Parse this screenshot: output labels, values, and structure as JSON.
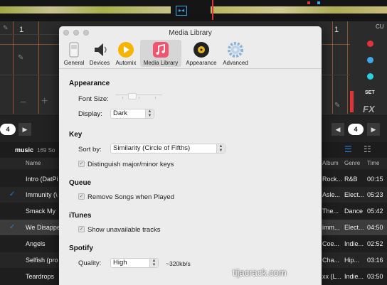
{
  "dialog": {
    "title": "Media Library",
    "tabs": [
      {
        "label": "General",
        "icon": "switch-icon"
      },
      {
        "label": "Devices",
        "icon": "speaker-icon"
      },
      {
        "label": "Automix",
        "icon": "play-circle-icon"
      },
      {
        "label": "Media Library",
        "icon": "music-library-icon",
        "selected": true
      },
      {
        "label": "Appearance",
        "icon": "appearance-disc-icon"
      },
      {
        "label": "Advanced",
        "icon": "gear-icon"
      }
    ],
    "appearance": {
      "heading": "Appearance",
      "font_size_label": "Font Size:",
      "display_label": "Display:",
      "display_value": "Dark"
    },
    "key": {
      "heading": "Key",
      "sort_by_label": "Sort by:",
      "sort_by_value": "Similarity (Circle of Fifths)",
      "distinguish_label": "Distinguish major/minor keys",
      "distinguish_checked": true
    },
    "queue": {
      "heading": "Queue",
      "remove_label": "Remove Songs when Played",
      "remove_checked": true
    },
    "itunes": {
      "heading": "iTunes",
      "show_unavailable_label": "Show unavailable tracks",
      "show_unavailable_checked": true
    },
    "spotify": {
      "heading": "Spotify",
      "quality_label": "Quality:",
      "quality_value": "High",
      "bitrate": "~320kb/s"
    }
  },
  "background": {
    "deck_left_number": "1",
    "deck_right_label": "CU",
    "set_label": "SET",
    "fx_label": "FX",
    "loop_left": "4",
    "loop_right": "4",
    "library_title": "music",
    "library_count": "169 So",
    "columns": {
      "name": "Name",
      "album": "Album",
      "genre": "Genre",
      "time": "Time"
    },
    "tracks": [
      {
        "name": "Intro (DatPi",
        "album": "Rock...",
        "genre": "R&B",
        "time": "00:15",
        "check": false
      },
      {
        "name": "Immunity (\\",
        "album": "Asle...",
        "genre": "Elect...",
        "time": "05:23",
        "check": true
      },
      {
        "name": "Smack My",
        "album": "The...",
        "genre": "Dance",
        "time": "05:42",
        "check": false
      },
      {
        "name": "We Disappe",
        "album": "imm...",
        "genre": "Elect...",
        "time": "04:50",
        "check": true
      },
      {
        "name": "Angels",
        "album": "Coe...",
        "genre": "Indie...",
        "time": "02:52",
        "check": false
      },
      {
        "name": "Selfish (pro",
        "album": "Cha...",
        "genre": "Hip...",
        "time": "03:16",
        "check": false
      },
      {
        "name": "Teardrops",
        "album": "xx (L...",
        "genre": "Indie...",
        "time": "03:50",
        "check": false
      }
    ]
  },
  "watermark": "tijacrack.com",
  "colors": {
    "deck_grid": "#e4762d",
    "dialog_bg": "#ececec",
    "accent_blue": "#2f7bd6",
    "dot_red": "#e0343a",
    "dot_blue": "#3fa9e8",
    "dot_cyan": "#29d0e0"
  }
}
